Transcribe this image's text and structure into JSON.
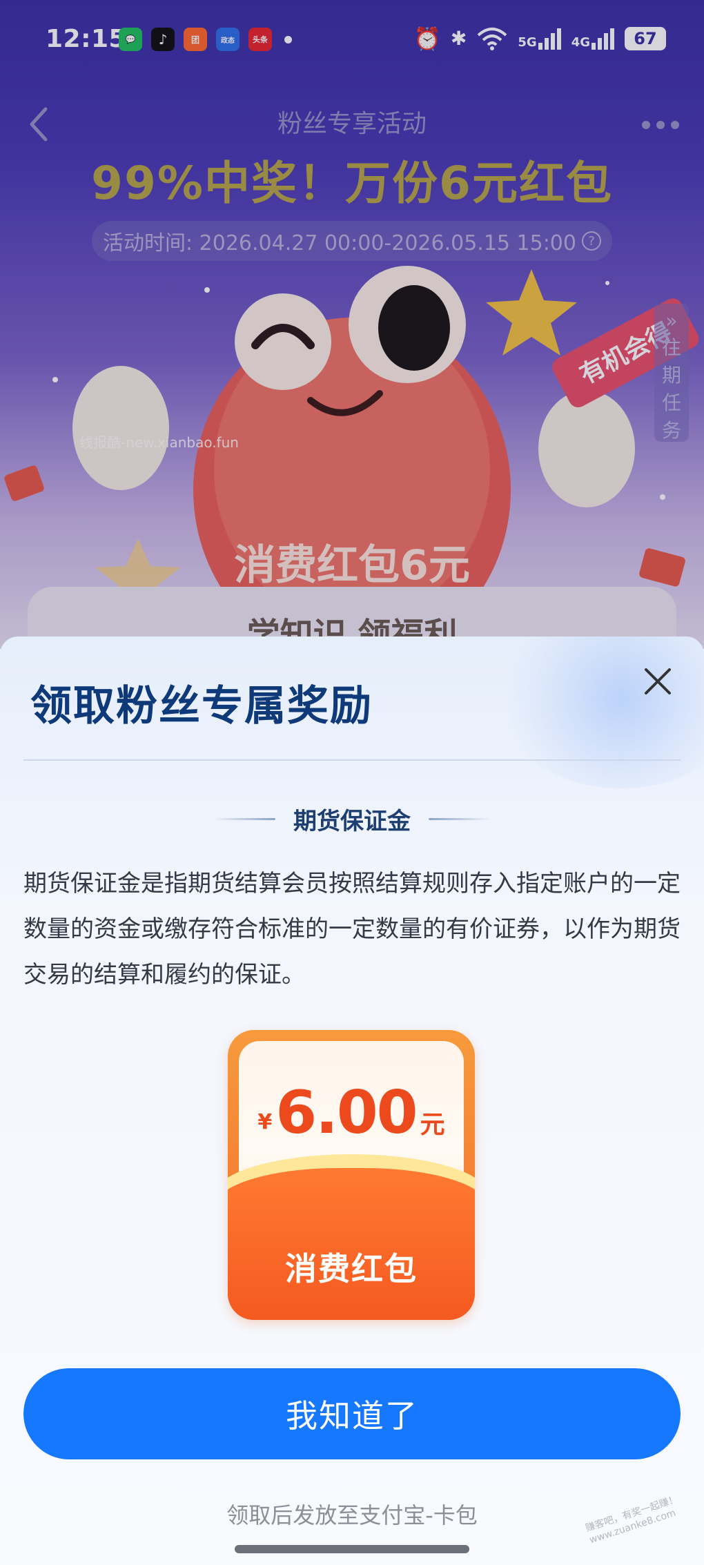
{
  "status_bar": {
    "time": "12:15",
    "apps": [
      {
        "name": "wechat",
        "glyph": "💬",
        "color": "#20c160"
      },
      {
        "name": "tiktok",
        "glyph": "♪",
        "color": "#111111"
      },
      {
        "name": "meituan",
        "glyph": "团",
        "color": "#ff6a2b"
      },
      {
        "name": "app-blue",
        "glyph": "政态",
        "color": "#2f6fe8"
      },
      {
        "name": "toutiao",
        "glyph": "头条",
        "color": "#e8262c"
      }
    ],
    "network_5g": "5G",
    "network_4g": "4G",
    "battery": "67"
  },
  "background": {
    "page_title": "粉丝专享活动",
    "headline": "99%中奖！万份6元红包",
    "period": "活动时间: 2026.04.27 00:00-2026.05.15 15:00",
    "side_tab": "往期任务",
    "mascot_caption": "消费红包6元",
    "badge": "有机会得",
    "card_peek": "学知识 领福利",
    "watermark": "线报酷-new.xianbao.fun"
  },
  "sheet": {
    "title": "领取粉丝专属奖励",
    "section_title": "期货保证金",
    "description": "期货保证金是指期货结算会员按照结算规则存入指定账户的一定数量的资金或缴存符合标准的一定数量的有价证券，以作为期货交易的结算和履约的保证。",
    "packet": {
      "currency": "¥",
      "amount": "6.00",
      "unit": "元",
      "label": "消费红包"
    },
    "cta_label": "我知道了",
    "footnote": "领取后发放至支付宝-卡包",
    "corner_watermark": "赚客吧，有奖一起赚！ www.zuanke8.com"
  },
  "colors": {
    "accent": "#1677ff",
    "title": "#0f3a7a",
    "packet_orange": "#f26a2a",
    "headline_gold": "#b6a548"
  }
}
